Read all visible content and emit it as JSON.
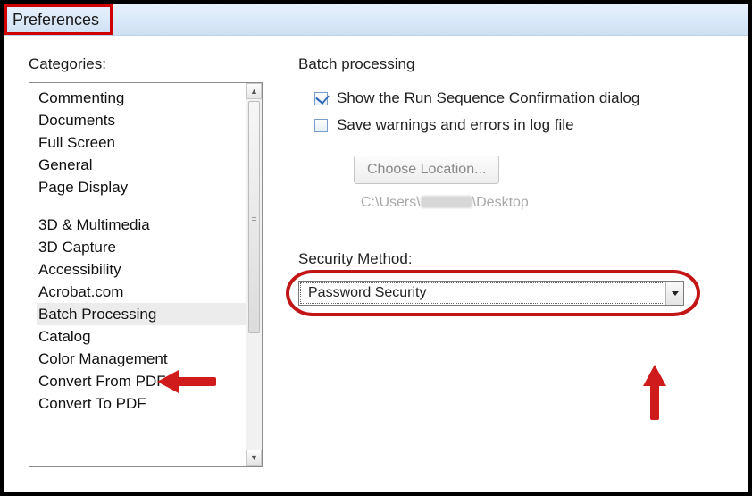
{
  "window": {
    "title": "Preferences"
  },
  "sidebar": {
    "label": "Categories:",
    "top_items": [
      "Commenting",
      "Documents",
      "Full Screen",
      "General",
      "Page Display"
    ],
    "bottom_items": [
      "3D & Multimedia",
      "3D Capture",
      "Accessibility",
      "Acrobat.com",
      "Batch Processing",
      "Catalog",
      "Color Management",
      "Convert From PDF",
      "Convert To PDF"
    ],
    "selected": "Batch Processing"
  },
  "panel": {
    "title": "Batch processing",
    "check_show_confirm": "Show the Run Sequence Confirmation dialog",
    "check_save_log": "Save warnings and errors in log file",
    "choose_location": "Choose Location...",
    "path_prefix": "C:\\Users\\",
    "path_suffix": "\\Desktop",
    "security_method_label": "Security Method:",
    "security_method_value": "Password Security"
  }
}
